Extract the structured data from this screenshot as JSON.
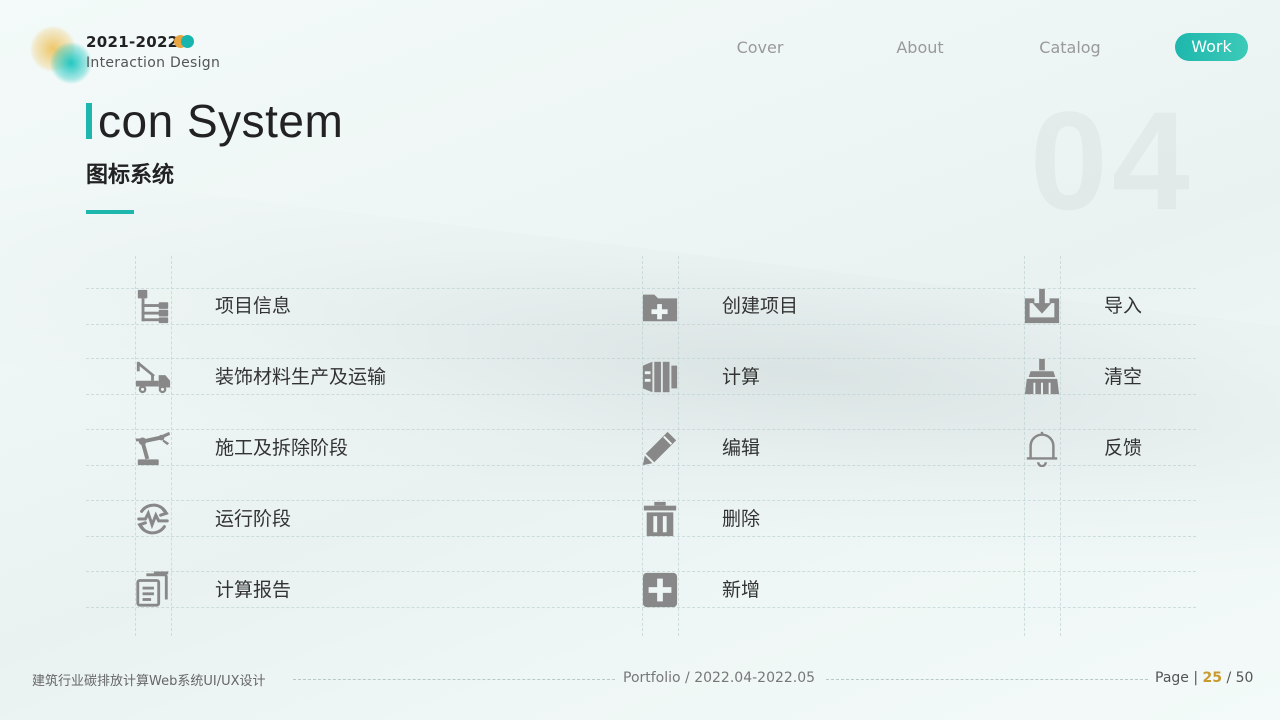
{
  "brand": {
    "year": "2021-2022",
    "subtitle": "Interaction Design"
  },
  "nav": {
    "cover": "Cover",
    "about": "About",
    "catalog": "Catalog",
    "work": "Work"
  },
  "heading": {
    "title_first": "I",
    "title_rest": "con System",
    "subtitle": "图标系统",
    "section_number": "04"
  },
  "icons": {
    "col1": [
      "项目信息",
      "装饰材料生产及运输",
      "施工及拆除阶段",
      "运行阶段",
      "计算报告"
    ],
    "col2": [
      "创建项目",
      "计算",
      "编辑",
      "删除",
      "新增"
    ],
    "col3": [
      "导入",
      "清空",
      "反馈"
    ]
  },
  "icon_names": {
    "col1": [
      "hierarchy-icon",
      "crane-truck-icon",
      "robot-arm-icon",
      "cycle-pulse-icon",
      "documents-icon"
    ],
    "col2": [
      "folder-add-icon",
      "calculate-icon",
      "pencil-icon",
      "trash-icon",
      "plus-square-icon"
    ],
    "col3": [
      "import-icon",
      "broom-icon",
      "bell-icon"
    ]
  },
  "colors": {
    "accent": "#1eb7ad",
    "icon": "#888888",
    "page_current": "#c99a2e"
  },
  "footer": {
    "left": "建筑行业碳排放计算Web系统UI/UX设计",
    "middle": "Portfolio / 2022.04-2022.05",
    "page_label": "Page",
    "page_sep": "|",
    "page_current": "25",
    "page_total": "/ 50"
  }
}
